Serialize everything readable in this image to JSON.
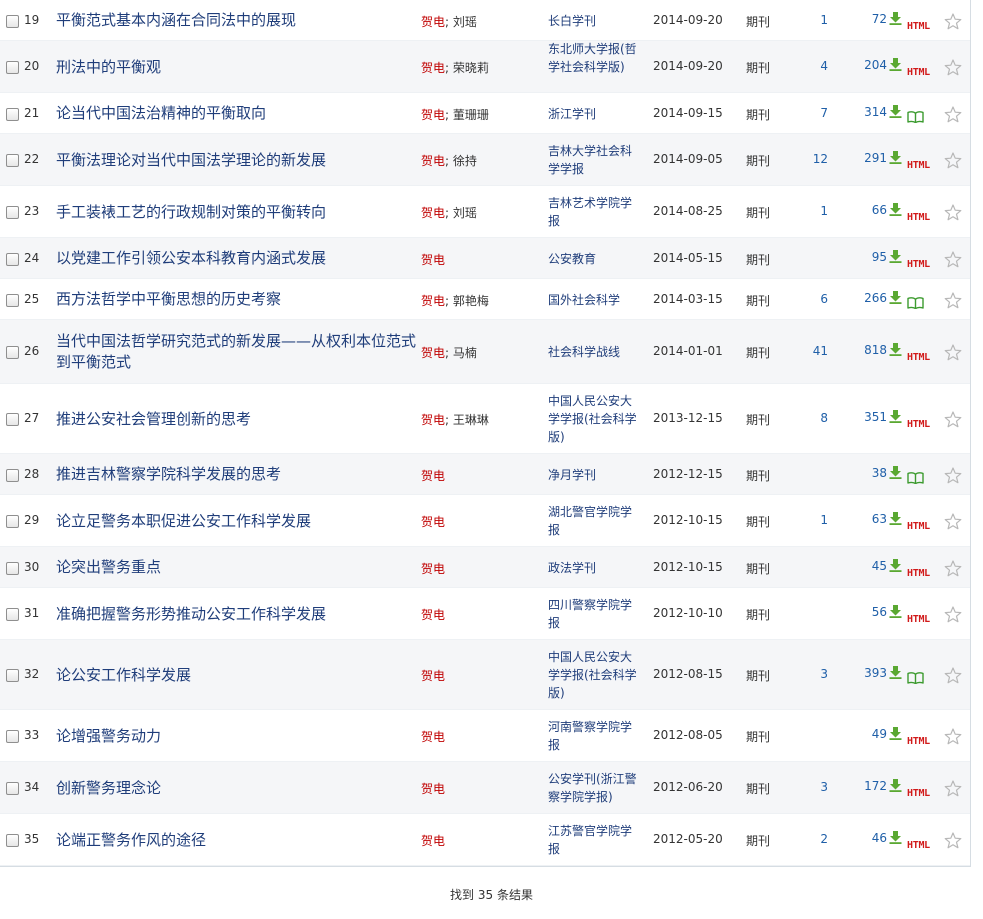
{
  "separator": ";",
  "html_label": "HTML",
  "icons": {
    "checkbox": "checkbox-icon",
    "download": "download-arrow-icon",
    "html": "html-icon",
    "read": "open-book-icon",
    "star": "star-outline-icon"
  },
  "colors": {
    "title_link": "#1f3d7a",
    "author_primary": "#c00000",
    "download_icon": "#5aa832",
    "html_badge": "#d11a1a",
    "alt_row_bg": "#f5f6f8"
  },
  "rows": [
    {
      "num": "19",
      "title": "平衡范式基本内涵在合同法中的展现",
      "author_main": "贺电",
      "author_co": "刘瑶",
      "source": "长白学刊",
      "date": "2014-09-20",
      "db": "期刊",
      "cite": "1",
      "downloads": "72",
      "read": "html"
    },
    {
      "num": "20",
      "title": "刑法中的平衡观",
      "author_main": "贺电",
      "author_co": "荣晓莉",
      "source": "东北师大学报(哲学社会科学版)",
      "date": "2014-09-20",
      "db": "期刊",
      "cite": "4",
      "downloads": "204",
      "read": "html"
    },
    {
      "num": "21",
      "title": "论当代中国法治精神的平衡取向",
      "author_main": "贺电",
      "author_co": "董珊珊",
      "source": "浙江学刊",
      "date": "2014-09-15",
      "db": "期刊",
      "cite": "7",
      "downloads": "314",
      "read": "book"
    },
    {
      "num": "22",
      "title": "平衡法理论对当代中国法学理论的新发展",
      "author_main": "贺电",
      "author_co": "徐持",
      "source": "吉林大学社会科学学报",
      "date": "2014-09-05",
      "db": "期刊",
      "cite": "12",
      "downloads": "291",
      "read": "html"
    },
    {
      "num": "23",
      "title": "手工装裱工艺的行政规制对策的平衡转向",
      "author_main": "贺电",
      "author_co": "刘瑶",
      "source": "吉林艺术学院学报",
      "date": "2014-08-25",
      "db": "期刊",
      "cite": "1",
      "downloads": "66",
      "read": "html"
    },
    {
      "num": "24",
      "title": "以党建工作引领公安本科教育内涵式发展",
      "author_main": "贺电",
      "author_co": "",
      "source": "公安教育",
      "date": "2014-05-15",
      "db": "期刊",
      "cite": "",
      "downloads": "95",
      "read": "html"
    },
    {
      "num": "25",
      "title": "西方法哲学中平衡思想的历史考察",
      "author_main": "贺电",
      "author_co": "郭艳梅",
      "source": "国外社会科学",
      "date": "2014-03-15",
      "db": "期刊",
      "cite": "6",
      "downloads": "266",
      "read": "book"
    },
    {
      "num": "26",
      "title": "当代中国法哲学研究范式的新发展——从权利本位范式到平衡范式",
      "author_main": "贺电",
      "author_co": "马楠",
      "source": "社会科学战线",
      "date": "2014-01-01",
      "db": "期刊",
      "cite": "41",
      "downloads": "818",
      "read": "html"
    },
    {
      "num": "27",
      "title": "推进公安社会管理创新的思考",
      "author_main": "贺电",
      "author_co": "王琳琳",
      "source": "中国人民公安大学学报(社会科学版)",
      "date": "2013-12-15",
      "db": "期刊",
      "cite": "8",
      "downloads": "351",
      "read": "html"
    },
    {
      "num": "28",
      "title": "推进吉林警察学院科学发展的思考",
      "author_main": "贺电",
      "author_co": "",
      "source": "净月学刊",
      "date": "2012-12-15",
      "db": "期刊",
      "cite": "",
      "downloads": "38",
      "read": "book"
    },
    {
      "num": "29",
      "title": "论立足警务本职促进公安工作科学发展",
      "author_main": "贺电",
      "author_co": "",
      "source": "湖北警官学院学报",
      "date": "2012-10-15",
      "db": "期刊",
      "cite": "1",
      "downloads": "63",
      "read": "html"
    },
    {
      "num": "30",
      "title": "论突出警务重点",
      "author_main": "贺电",
      "author_co": "",
      "source": "政法学刊",
      "date": "2012-10-15",
      "db": "期刊",
      "cite": "",
      "downloads": "45",
      "read": "html"
    },
    {
      "num": "31",
      "title": "准确把握警务形势推动公安工作科学发展",
      "author_main": "贺电",
      "author_co": "",
      "source": "四川警察学院学报",
      "date": "2012-10-10",
      "db": "期刊",
      "cite": "",
      "downloads": "56",
      "read": "html"
    },
    {
      "num": "32",
      "title": "论公安工作科学发展",
      "author_main": "贺电",
      "author_co": "",
      "source": "中国人民公安大学学报(社会科学版)",
      "date": "2012-08-15",
      "db": "期刊",
      "cite": "3",
      "downloads": "393",
      "read": "book"
    },
    {
      "num": "33",
      "title": "论增强警务动力",
      "author_main": "贺电",
      "author_co": "",
      "source": "河南警察学院学报",
      "date": "2012-08-05",
      "db": "期刊",
      "cite": "",
      "downloads": "49",
      "read": "html"
    },
    {
      "num": "34",
      "title": "创新警务理念论",
      "author_main": "贺电",
      "author_co": "",
      "source": "公安学刊(浙江警察学院学报)",
      "date": "2012-06-20",
      "db": "期刊",
      "cite": "3",
      "downloads": "172",
      "read": "html"
    },
    {
      "num": "35",
      "title": "论端正警务作风的途径",
      "author_main": "贺电",
      "author_co": "",
      "source": "江苏警官学院学报",
      "date": "2012-05-20",
      "db": "期刊",
      "cite": "2",
      "downloads": "46",
      "read": "html"
    }
  ],
  "summary": "找到 35 条结果"
}
